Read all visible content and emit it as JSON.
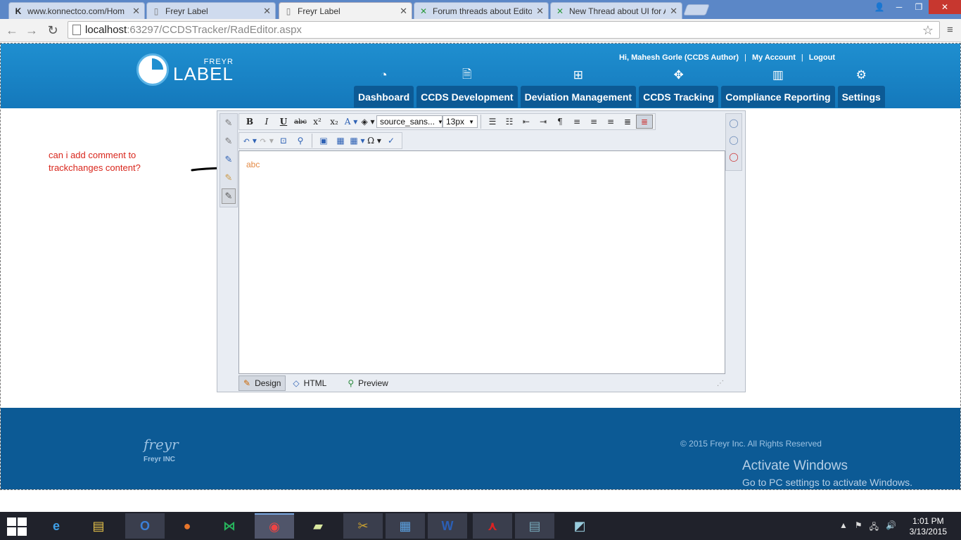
{
  "browser": {
    "tabs": [
      {
        "favicon": "k-logo-icon",
        "title": "www.konnectco.com/Hom"
      },
      {
        "favicon": "page-icon",
        "title": "Freyr Label"
      },
      {
        "favicon": "page-icon",
        "title": "Freyr Label",
        "active": true
      },
      {
        "favicon": "forum-icon",
        "title": "Forum threads about Edito"
      },
      {
        "favicon": "forum-icon",
        "title": "New Thread about UI for A"
      }
    ],
    "url_host": "localhost",
    "url_rest": ":63297/CCDSTracker/RadEditor.aspx"
  },
  "header": {
    "logo_small": "FREYR",
    "logo_big": "LABEL",
    "greeting": "Hi, Mahesh Gorle (CCDS Author)",
    "my_account": "My Account",
    "logout": "Logout",
    "nav": [
      {
        "label": "Dashboard",
        "icon": "dashboard-icon"
      },
      {
        "label": "CCDS Development",
        "icon": "document-icon"
      },
      {
        "label": "Deviation Management",
        "icon": "hierarchy-icon"
      },
      {
        "label": "CCDS Tracking",
        "icon": "crosshair-icon"
      },
      {
        "label": "Compliance Reporting",
        "icon": "bar-chart-icon"
      },
      {
        "label": "Settings",
        "icon": "gear-icon"
      }
    ]
  },
  "annotation": {
    "text": "can i add comment to trackchanges content?"
  },
  "editor": {
    "font_name": "source_sans...",
    "font_size": "13px",
    "content": "abc",
    "modes": [
      "Design",
      "HTML",
      "Preview"
    ]
  },
  "footer": {
    "logo": "freyr",
    "logo_sub": "Freyr INC",
    "copyright": "© 2015 Freyr Inc. All Rights Reserved",
    "activate_title": "Activate Windows",
    "activate_sub": "Go to PC settings to activate Windows."
  },
  "taskbar": {
    "time": "1:01 PM",
    "date": "3/13/2015"
  }
}
